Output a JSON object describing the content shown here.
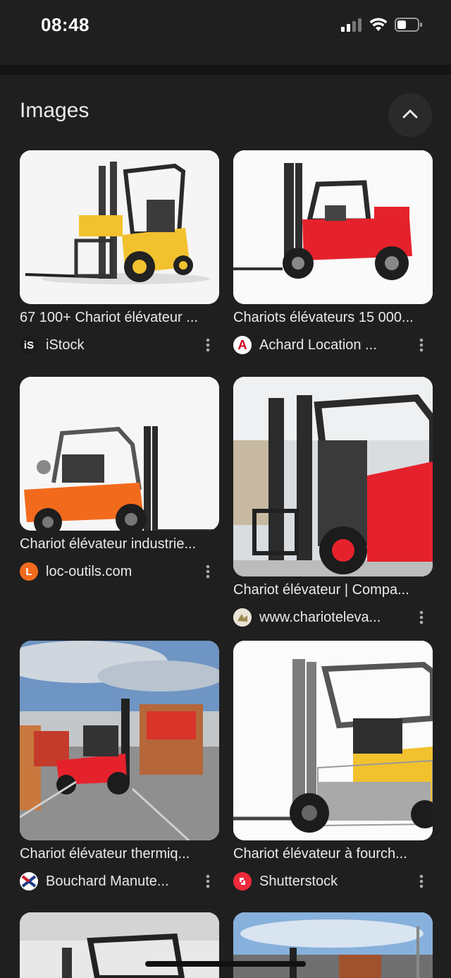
{
  "status": {
    "time": "08:48",
    "icons": [
      "signal-icon",
      "wifi-icon",
      "battery-icon"
    ]
  },
  "section": {
    "title": "Images",
    "collapse_icon": "chevron-up-icon"
  },
  "results": [
    {
      "title": "67 100+ Chariot élévateur ...",
      "source": "iStock",
      "favicon_text": "iS",
      "favicon_color": "#1b1b1b",
      "favicon_fg": "#ffffff"
    },
    {
      "title": "Chariots élévateurs 15 000...",
      "source": "Achard Location ...",
      "favicon_text": "A",
      "favicon_color": "#ffffff",
      "favicon_fg": "#d0021b"
    },
    {
      "title": "Chariot élévateur industrie...",
      "source": "loc-outils.com",
      "favicon_text": "L",
      "favicon_color": "#f26b1d",
      "favicon_fg": "#ffffff"
    },
    {
      "title": "Chariot élévateur | Compa...",
      "source": "www.chariotelevа...",
      "favicon_text": "",
      "favicon_color": "#d9d3c4",
      "favicon_fg": "#6b5a2e"
    },
    {
      "title": "Chariot élévateur thermiq...",
      "source": "Bouchard Manute...",
      "favicon_text": "",
      "favicon_color": "#ffffff",
      "favicon_fg": "#1f3b8a"
    },
    {
      "title": "Chariot élévateur à fourch...",
      "source": "Shutterstock",
      "favicon_text": "",
      "favicon_color": "#ee2a3a",
      "favicon_fg": "#ffffff"
    }
  ],
  "colors": {
    "background": "#1f1f1f",
    "text": "#e8eaed",
    "yellow": "#f2c12e",
    "red": "#e5222c",
    "orange": "#f26b1d"
  }
}
